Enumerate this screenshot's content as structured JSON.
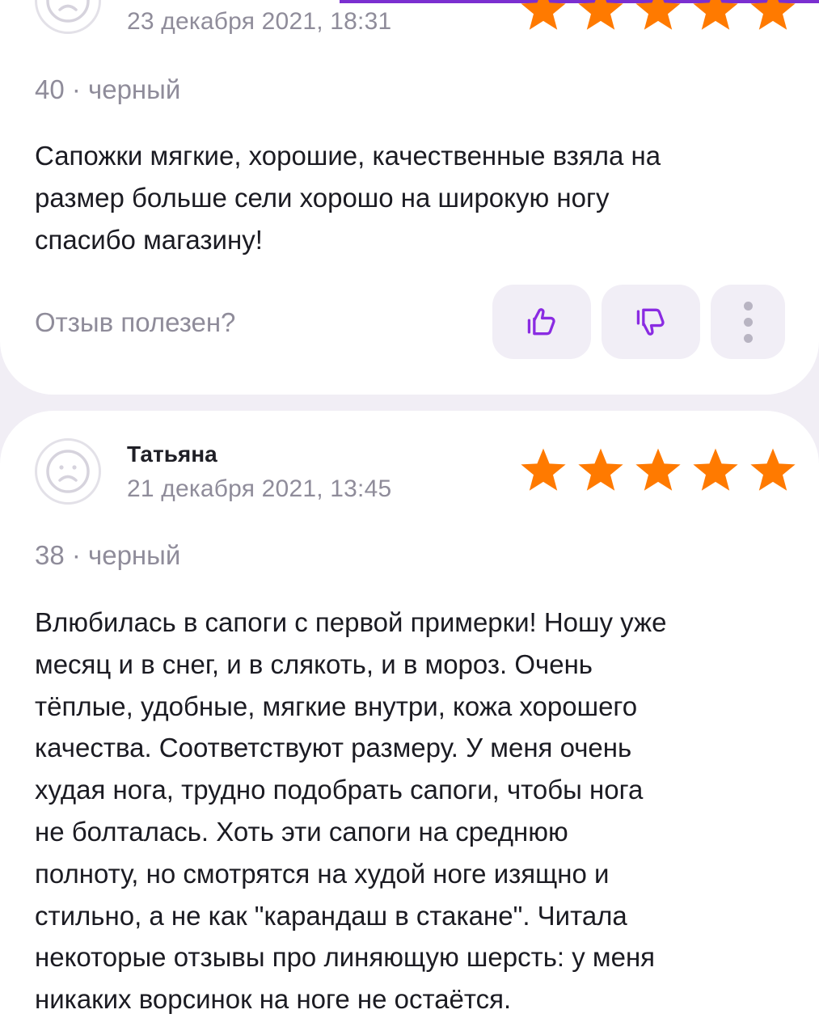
{
  "colors": {
    "accent": "#7b2fd0",
    "star": "#ff7a00",
    "muted": "#8f8c9a",
    "button_bg": "#f1eef6"
  },
  "reviews": [
    {
      "author": "",
      "date": "23 декабря 2021, 18:31",
      "rating": 5,
      "variant": "40 · черный",
      "text_lines": [
        "Сапожки мягкие, хорошие, качественные взяла на",
        "размер больше сели хорошо на широкую ногу",
        "спасибо магазину!"
      ],
      "helpful_label": "Отзыв полезен?",
      "icons": {
        "avatar": "sad-face-icon",
        "like": "thumbs-up-icon",
        "dislike": "thumbs-down-icon",
        "more": "more-vertical-icon"
      }
    },
    {
      "author": "Татьяна",
      "date": "21 декабря 2021, 13:45",
      "rating": 5,
      "variant": "38 · черный",
      "text_lines": [
        "Влюбилась в сапоги с первой примерки! Ношу уже",
        "месяц и в снег, и в слякоть, и в мороз. Очень",
        "тёплые, удобные, мягкие внутри, кожа хорошего",
        "качества. Соответствуют размеру. У меня очень",
        "худая нога, трудно подобрать сапоги, чтобы нога",
        "не болталась. Хоть эти сапоги на среднюю",
        "полноту, но смотрятся на худой ноге изящно и",
        "стильно, а не как \"карандаш в стакане\". Читала",
        "некоторые отзывы про линяющую шерсть: у меня",
        "никаких ворсинок на ноге не остаётся."
      ],
      "icons": {
        "avatar": "sad-face-icon"
      }
    }
  ]
}
